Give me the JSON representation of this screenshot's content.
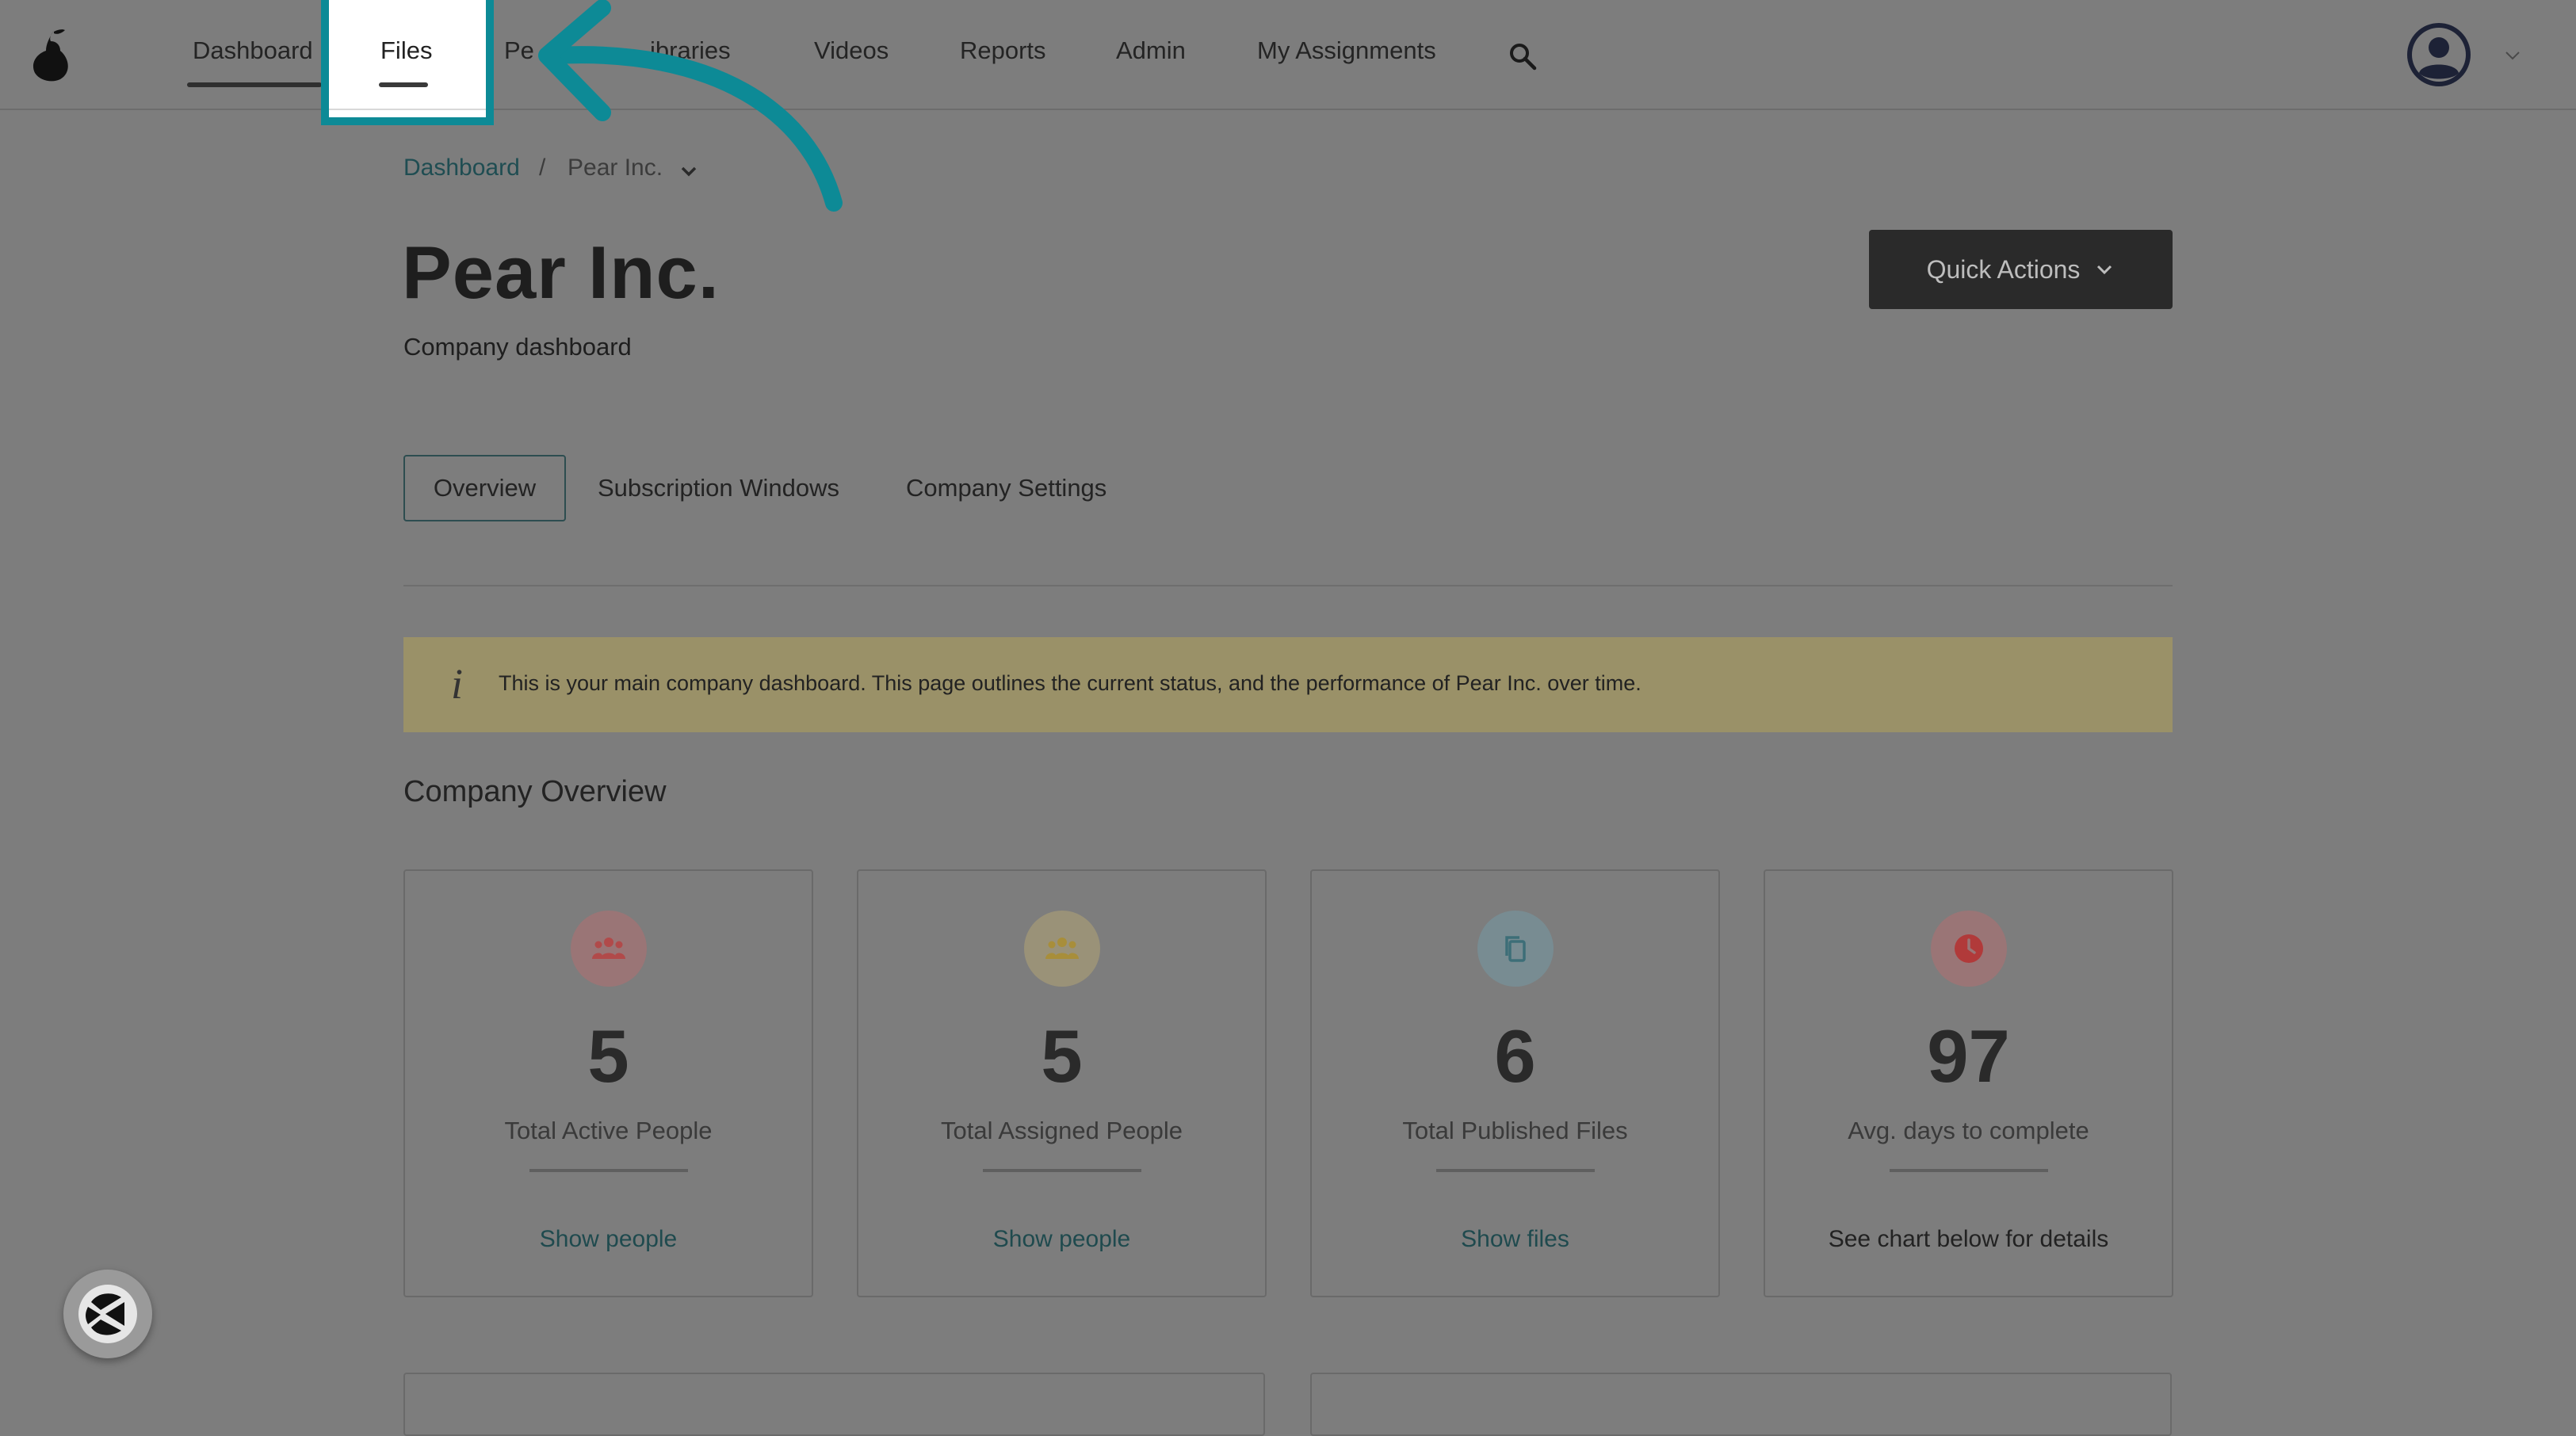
{
  "nav": {
    "items": [
      "Dashboard",
      "Files",
      "People",
      "Libraries",
      "Videos",
      "Reports",
      "Admin",
      "My Assignments"
    ],
    "visible_people": "Pe",
    "visible_libraries": "ibraries"
  },
  "breadcrumb": {
    "root": "Dashboard",
    "separator": "/",
    "current": "Pear Inc."
  },
  "page": {
    "title": "Pear Inc.",
    "subtitle": "Company dashboard"
  },
  "quick_actions": {
    "label": "Quick Actions"
  },
  "tabs": [
    "Overview",
    "Subscription Windows",
    "Company Settings"
  ],
  "banner": {
    "icon": "i",
    "text": "This is your main company dashboard. This page outlines the current status, and the performance of Pear Inc. over time."
  },
  "overview": {
    "title": "Company Overview",
    "cards": [
      {
        "icon": "people-icon",
        "value": "5",
        "label": "Total Active People",
        "link": "Show people",
        "icon_bg": "#9a7576",
        "icon_color": "#b14a4a"
      },
      {
        "icon": "people-icon",
        "value": "5",
        "label": "Total Assigned People",
        "link": "Show people",
        "icon_bg": "#9a9278",
        "icon_color": "#a88e3a"
      },
      {
        "icon": "files-icon",
        "value": "6",
        "label": "Total Published Files",
        "link": "Show files",
        "icon_bg": "#788c92",
        "icon_color": "#3d6e78"
      },
      {
        "icon": "clock-icon",
        "value": "97",
        "label": "Avg. days to complete",
        "link": "See chart below for details",
        "icon_bg": "#9a7576",
        "icon_color": "#b13a3a"
      }
    ]
  },
  "colors": {
    "highlight": "#0d8a96",
    "overlay": "#7d7d7d",
    "banner": "#9a9168"
  }
}
